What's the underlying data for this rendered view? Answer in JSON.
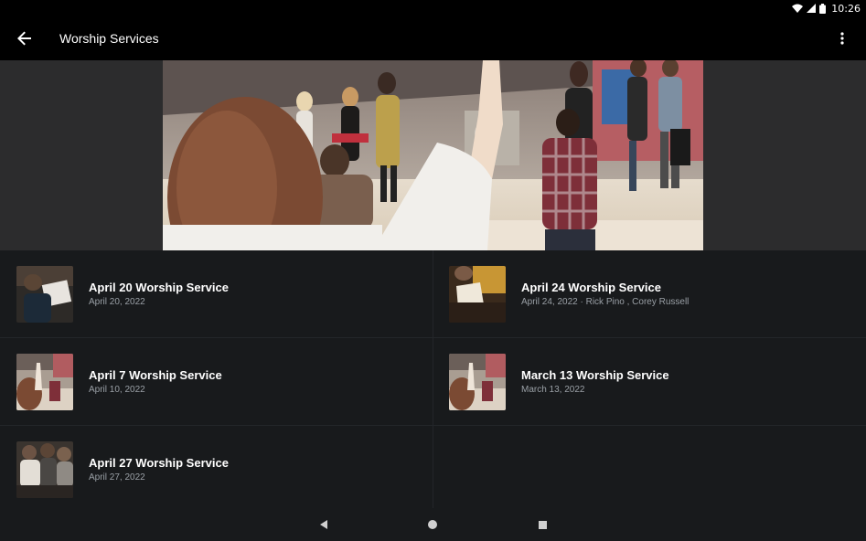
{
  "status_bar": {
    "time": "10:26"
  },
  "app_bar": {
    "title": "Worship Services"
  },
  "hero": {
    "image": "worship-band-stage-photo"
  },
  "services": [
    {
      "title": "April 20 Worship Service",
      "subtitle": "April 20, 2022"
    },
    {
      "title": "April 24 Worship Service",
      "subtitle": "April 24, 2022 · Rick Pino , Corey Russell"
    },
    {
      "title": "April 7 Worship Service",
      "subtitle": "April 10, 2022"
    },
    {
      "title": "March 13 Worship Service",
      "subtitle": "March 13, 2022"
    },
    {
      "title": "April 27 Worship Service",
      "subtitle": "April 27, 2022"
    }
  ],
  "colors": {
    "background": "#000000",
    "list_background": "#181a1c",
    "hero_background": "#2c2c2d",
    "subtitle": "#9aa0a6"
  }
}
